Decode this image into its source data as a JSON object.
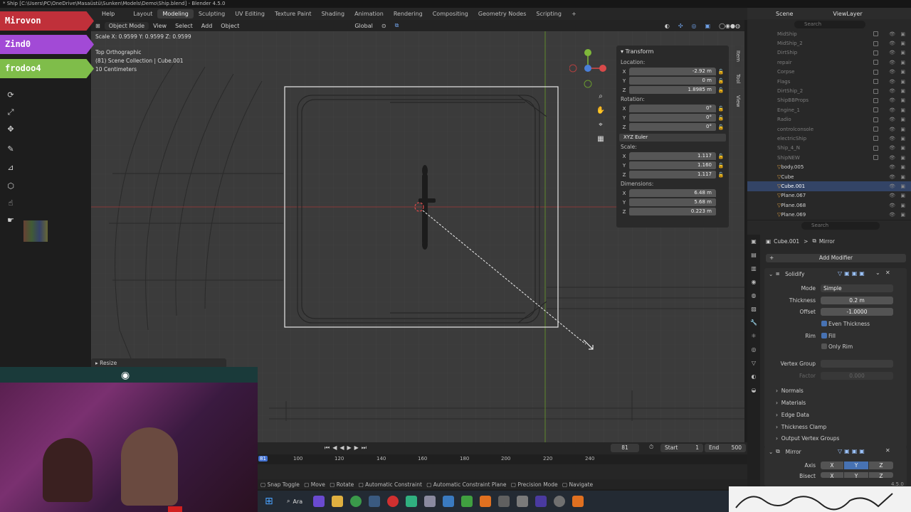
{
  "window": {
    "title": "* Ship [C:\\Users\\PC\\OneDrive\\Masaüstü\\Sunken\\Models\\Demo\\Ship.blend] - Blender 4.5.0"
  },
  "menu": [
    "Help"
  ],
  "workspaces": {
    "active": "Modeling",
    "tabs": [
      "Layout",
      "Modeling",
      "Sculpting",
      "UV Editing",
      "Texture Paint",
      "Shading",
      "Animation",
      "Rendering",
      "Compositing",
      "Geometry Nodes",
      "Scripting",
      "+"
    ]
  },
  "viewport_header": {
    "mode": "Object Mode",
    "menus": [
      "View",
      "Select",
      "Add",
      "Object"
    ],
    "orientation": "Global"
  },
  "operator_readout": "Scale X: 0.9599   Y: 0.9599   Z: 0.9599",
  "view_info": {
    "line1": "Top Orthographic",
    "line2": "(81) Scene Collection | Cube.001",
    "line3": "10 Centimeters"
  },
  "name_tags": [
    {
      "label": "Mirovon",
      "color": "#c0303a"
    },
    {
      "label": "Zind0",
      "color": "#a24ad6"
    },
    {
      "label": "frodoo4",
      "color": "#7fbd4a"
    }
  ],
  "transform_panel": {
    "title": "Transform",
    "location_label": "Location:",
    "location": [
      {
        "axis": "X",
        "value": "-2.92 m"
      },
      {
        "axis": "Y",
        "value": "0 m"
      },
      {
        "axis": "Z",
        "value": "1.8985 m"
      }
    ],
    "rotation_label": "Rotation:",
    "rotation": [
      {
        "axis": "X",
        "value": "0°"
      },
      {
        "axis": "Y",
        "value": "0°"
      },
      {
        "axis": "Z",
        "value": "0°"
      }
    ],
    "rotation_mode": "XYZ Euler",
    "scale_label": "Scale:",
    "scale": [
      {
        "axis": "X",
        "value": "1.117"
      },
      {
        "axis": "Y",
        "value": "1.160"
      },
      {
        "axis": "Z",
        "value": "1.117"
      }
    ],
    "dimensions_label": "Dimensions:",
    "dimensions": [
      {
        "axis": "X",
        "value": "6.48 m"
      },
      {
        "axis": "Y",
        "value": "5.68 m"
      },
      {
        "axis": "Z",
        "value": "0.223 m"
      }
    ]
  },
  "side_tabs": [
    "Item",
    "Tool",
    "View"
  ],
  "redo_panel": {
    "label": "Resize"
  },
  "outliner": {
    "scene": "Scene",
    "view_layer": "ViewLayer",
    "search_placeholder": "Search",
    "rows": [
      {
        "name": "MidShip",
        "on": false
      },
      {
        "name": "MidShip_2",
        "on": false
      },
      {
        "name": "DirtShip",
        "on": false
      },
      {
        "name": "repair",
        "on": false
      },
      {
        "name": "Corpse",
        "on": false
      },
      {
        "name": "Flags",
        "on": false
      },
      {
        "name": "DirtShip_2",
        "on": false
      },
      {
        "name": "ShipBBProps",
        "on": false
      },
      {
        "name": "Engine_1",
        "on": false
      },
      {
        "name": "Radio",
        "on": false
      },
      {
        "name": "controlconsole",
        "on": false
      },
      {
        "name": "electricShip",
        "on": false
      },
      {
        "name": "Ship_4_N",
        "on": false
      },
      {
        "name": "ShipNEW",
        "on": false
      },
      {
        "name": "body.005",
        "on": true
      },
      {
        "name": "Cube",
        "on": true
      },
      {
        "name": "Cube.001",
        "on": true,
        "selected": true
      },
      {
        "name": "Plane.067",
        "on": true
      },
      {
        "name": "Plane.068",
        "on": true
      },
      {
        "name": "Plane.069",
        "on": true
      }
    ]
  },
  "properties": {
    "search_placeholder": "Search",
    "breadcrumb_object": "Cube.001",
    "breadcrumb_sep": ">",
    "breadcrumb_modifier": "Mirror",
    "add_modifier": "Add Modifier",
    "solidify": {
      "name": "Solidify",
      "mode_label": "Mode",
      "mode": "Simple",
      "thickness_label": "Thickness",
      "thickness": "0.2 m",
      "offset_label": "Offset",
      "offset": "-1.0000",
      "even_thickness": "Even Thickness",
      "rim_label": "Rim",
      "fill": "Fill",
      "only_rim": "Only Rim",
      "vertex_group_label": "Vertex Group",
      "factor_label": "Factor",
      "factor": "0.000",
      "sections": [
        "Normals",
        "Materials",
        "Edge Data",
        "Thickness Clamp",
        "Output Vertex Groups"
      ]
    },
    "mirror": {
      "name": "Mirror",
      "axis_label": "Axis",
      "bisect_label": "Bisect",
      "axes": [
        "X",
        "Y",
        "Z"
      ]
    }
  },
  "timeline": {
    "frame": "81",
    "start_label": "Start",
    "start": "1",
    "end_label": "End",
    "end": "500",
    "ticks": [
      "100",
      "120",
      "140",
      "160",
      "180",
      "200",
      "220",
      "240"
    ],
    "current_tick": "81"
  },
  "statusbar": [
    "Snap Toggle",
    "Move",
    "Rotate",
    "Automatic Constraint",
    "Automatic Constraint Plane",
    "Precision Mode",
    "Navigate"
  ],
  "version": "4.5.0",
  "taskbar": {
    "search": "Ara"
  }
}
